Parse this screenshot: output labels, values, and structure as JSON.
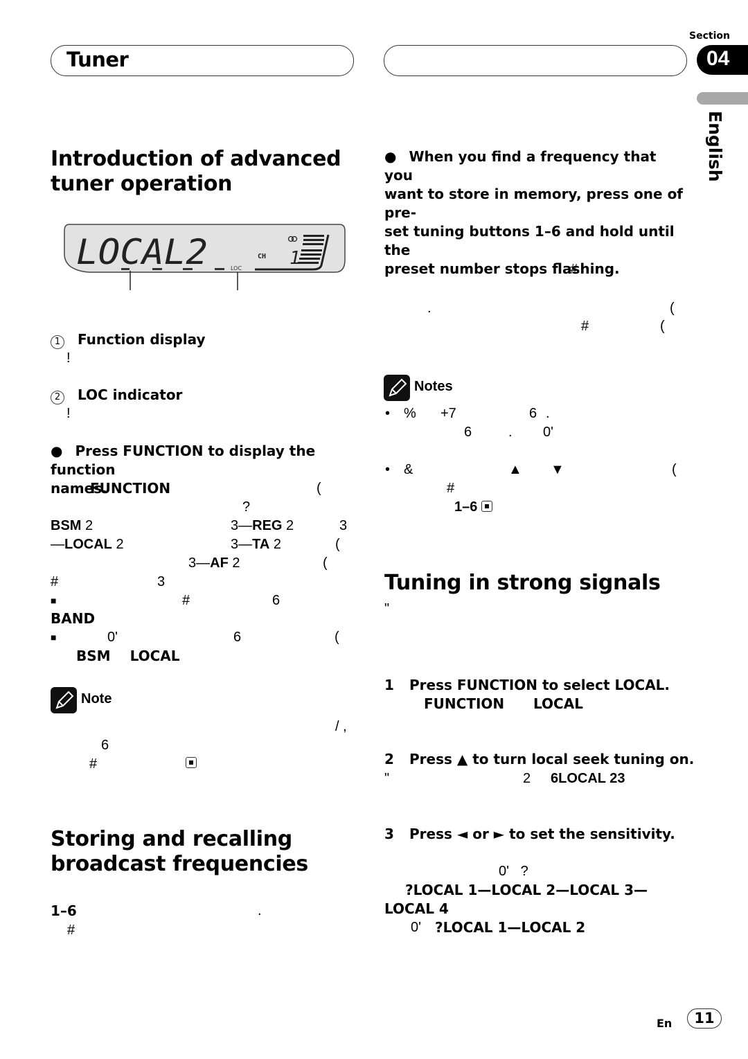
{
  "header": {
    "title": "Tuner",
    "section_label": "Section",
    "section_number": "04",
    "language_tab": "English"
  },
  "left": {
    "heading_intro": [
      "Introduction of advanced",
      "tuner operation"
    ],
    "lcd": {
      "main_text": "LOCAL2",
      "ch_label": "CH",
      "preset_digit": "1",
      "loc_label": "LOC"
    },
    "callouts": [
      {
        "number": "1",
        "label": "Function display",
        "sub": "!"
      },
      {
        "number": "2",
        "label": "LOC indicator",
        "sub": "!"
      }
    ],
    "press_function": {
      "lines": [
        "Press FUNCTION to display the function",
        "names."
      ]
    },
    "fragments": {
      "function": "FUNCTION",
      "paren1": "(",
      "q": "?",
      "bsm": "BSM",
      "two": "2",
      "three_dash": "3—",
      "reg": "REG",
      "three": "3",
      "dash": "—",
      "local": "LOCAL",
      "ta": "TA",
      "af": "AF",
      "hash": "#",
      "bullet_sq": "■",
      "six": "6",
      "band": "BAND",
      "zero_quote": "0'"
    },
    "note": {
      "label": "Note",
      "slash_comma": "/ ,",
      "six": "6",
      "hash": "#"
    },
    "heading_storing": [
      "Storing and recalling",
      "broadcast frequencies"
    ],
    "storing_range": "1–6",
    "storing_dot": ".",
    "storing_hash": "#"
  },
  "right": {
    "store_instruction": [
      "When you find a frequency that you",
      "want to store in memory, press one of pre-",
      "set tuning buttons 1–6 and hold until the",
      "preset number stops flashing."
    ],
    "frag_hash": "#",
    "frag_dot": ".",
    "frag_paren": "(",
    "notes": {
      "label": "Notes",
      "item1": {
        "a": "%",
        "b": "+7",
        "c": "6",
        "d": ".",
        "e": "6",
        "f": ".",
        "g": "0'"
      },
      "item2": {
        "a": "&",
        "up": "▲",
        "down": "▼",
        "paren": "(",
        "hash": "#",
        "range": "1–6"
      }
    },
    "heading_tuning": "Tuning in strong signals",
    "quote_mark": "\"",
    "steps": [
      {
        "num": "1",
        "text": "Press FUNCTION to select LOCAL.",
        "sub_function": "FUNCTION",
        "sub_local": "LOCAL"
      },
      {
        "num": "2",
        "text": "Press ▲ to turn local seek tuning on.",
        "sub_quote": "\"",
        "sub_two": "2",
        "sub_local": "6LOCAL 23"
      },
      {
        "num": "3",
        "text": "Press ◄ or ► to set the sensitivity."
      }
    ],
    "sensitivity": {
      "frag_top": "0'   ?",
      "fm_sequence_a": "?LOCAL 1—LOCAL 2—LOCAL 3—",
      "fm_sequence_b": "LOCAL 4",
      "am_prefix": "0'",
      "am_sequence": "?LOCAL 1—LOCAL 2"
    }
  },
  "footer": {
    "lang_code": "En",
    "page_number": "11"
  }
}
